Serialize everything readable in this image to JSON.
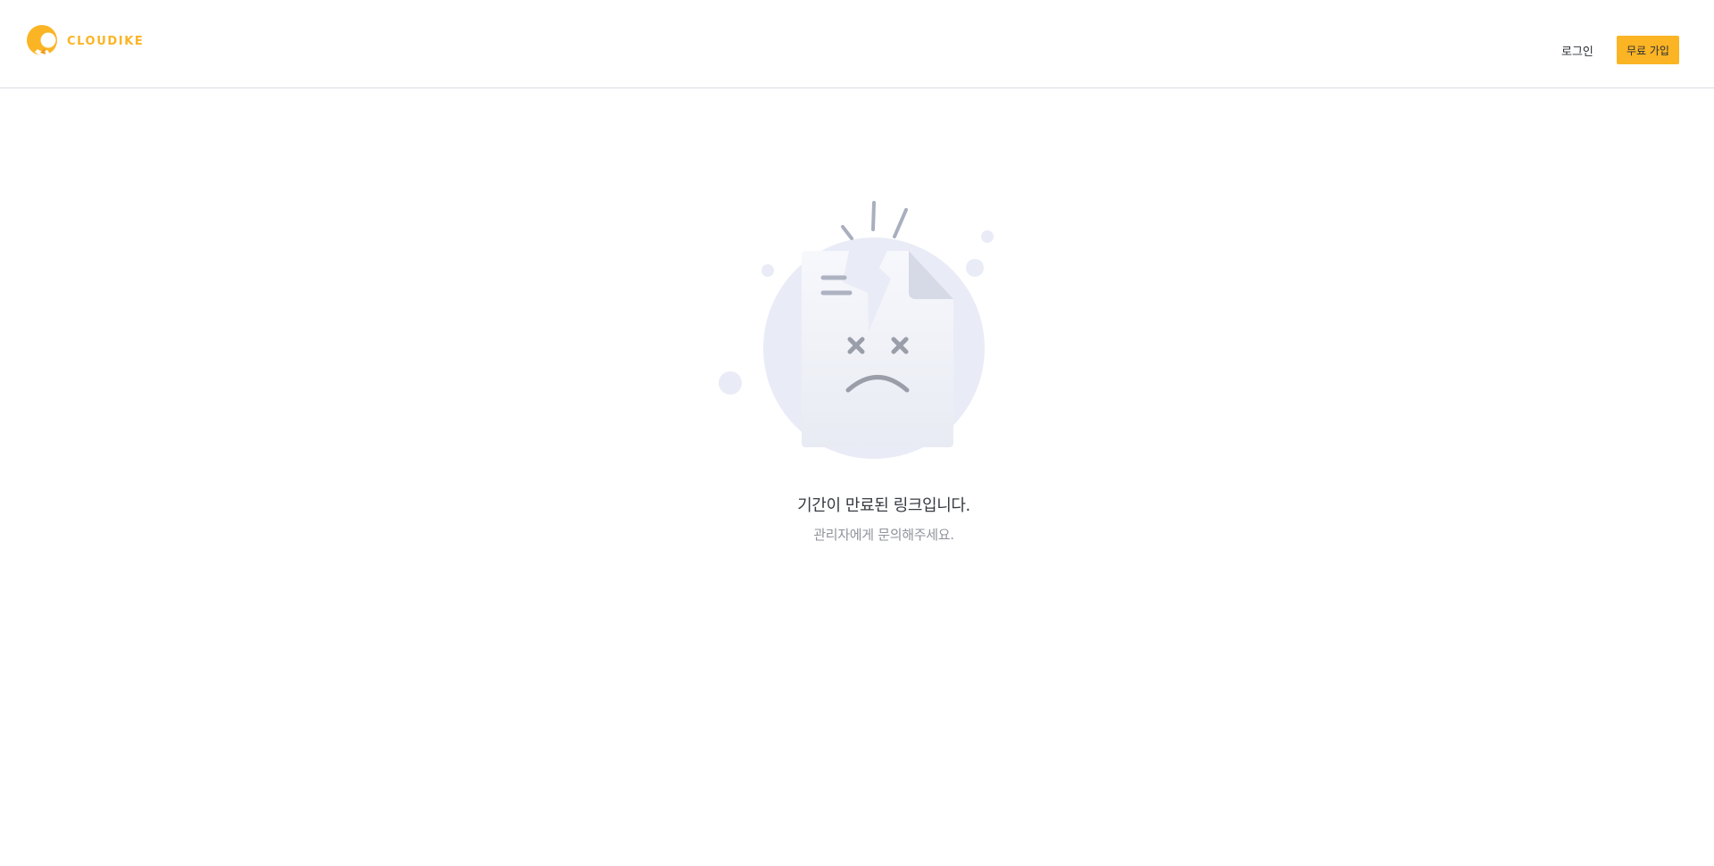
{
  "header": {
    "brand": "CLOUDIKE",
    "logo_icon": "cloudike-c-logo-icon",
    "login_label": "로그인",
    "signup_label": "무료 가입"
  },
  "main": {
    "illustration_icon": "broken-file-sad-face-icon",
    "title": "기간이 만료된 링크입니다.",
    "subtitle": "관리자에게 문의해주세요."
  },
  "colors": {
    "accent": "#fbb424",
    "illustration_bg": "#e9ecf6",
    "illustration_face": "#9a9ea9"
  }
}
